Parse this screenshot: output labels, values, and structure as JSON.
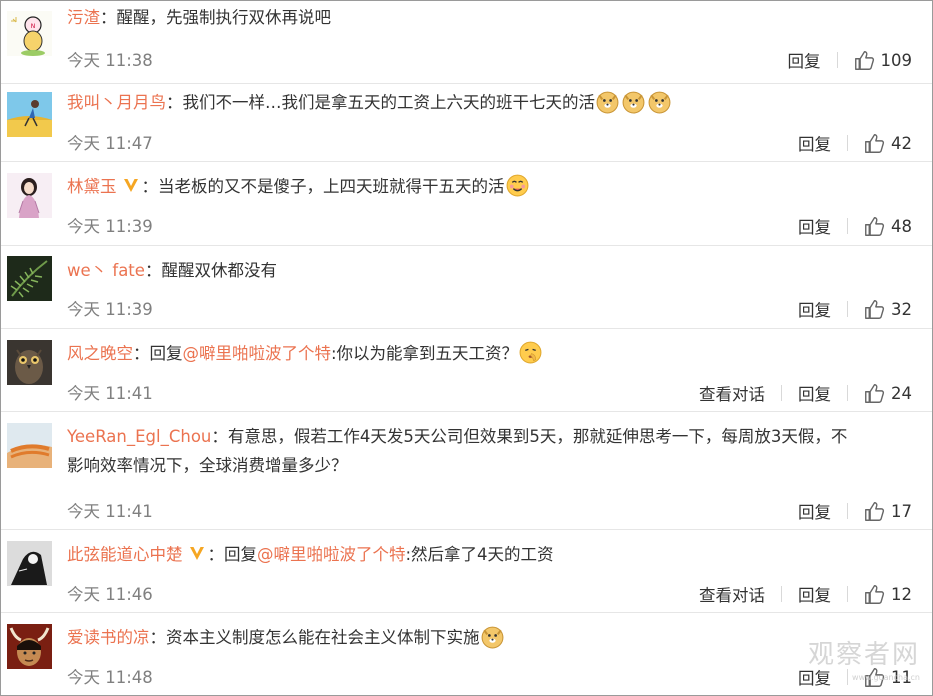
{
  "comments": [
    {
      "user": "污渣",
      "verified": false,
      "reply_prefix": "",
      "mention": "",
      "after_mention": "",
      "text": "：醒醒，先强制执行双休再说吧",
      "text2": "",
      "emojis": 0,
      "time": "今天 11:38",
      "view_conversation": "",
      "reply": "回复",
      "likes": "109"
    },
    {
      "user": "我叫丶月月鸟",
      "verified": false,
      "reply_prefix": "",
      "mention": "",
      "after_mention": "",
      "text": "：我们不一样…我们是拿五天的工资上六天的班干七天的活",
      "text2": "",
      "emojis": 3,
      "time": "今天 11:47",
      "view_conversation": "",
      "reply": "回复",
      "likes": "42"
    },
    {
      "user": "林黛玉",
      "verified": true,
      "reply_prefix": "",
      "mention": "",
      "after_mention": "",
      "text": "：当老板的又不是傻子，上四天班就得干五天的活",
      "text2": "",
      "emojis": 1,
      "time": "今天 11:39",
      "view_conversation": "",
      "reply": "回复",
      "likes": "48"
    },
    {
      "user": "we丶 fate",
      "verified": false,
      "reply_prefix": "",
      "mention": "",
      "after_mention": "",
      "text": "：醒醒双休都没有",
      "text2": "",
      "emojis": 0,
      "time": "今天 11:39",
      "view_conversation": "",
      "reply": "回复",
      "likes": "32"
    },
    {
      "user": "风之晚空",
      "verified": false,
      "reply_prefix": "：回复",
      "mention": "@噼里啪啦波了个特",
      "after_mention": ":你以为能拿到五天工资？",
      "text": "",
      "text2": "",
      "emojis": 1,
      "time": "今天 11:41",
      "view_conversation": "查看对话",
      "reply": "回复",
      "likes": "24"
    },
    {
      "user": "YeeRan_Egl_Chou",
      "verified": false,
      "reply_prefix": "",
      "mention": "",
      "after_mention": "",
      "text": "：有意思，假若工作4天发5天公司但效果到5天，那就延伸思考一下，每周放3天假，不",
      "text2": "影响效率情况下，全球消费增量多少？",
      "emojis": 0,
      "time": "今天 11:41",
      "view_conversation": "",
      "reply": "回复",
      "likes": "17"
    },
    {
      "user": "此弦能道心中楚",
      "verified": true,
      "reply_prefix": "：回复",
      "mention": "@噼里啪啦波了个特",
      "after_mention": ":然后拿了4天的工资",
      "text": "",
      "text2": "",
      "emojis": 0,
      "time": "今天 11:46",
      "view_conversation": "查看对话",
      "reply": "回复",
      "likes": "12"
    },
    {
      "user": "爱读书的凉",
      "verified": false,
      "reply_prefix": "",
      "mention": "",
      "after_mention": "",
      "text": "：资本主义制度怎么能在社会主义体制下实施",
      "text2": "",
      "emojis": 1,
      "time": "今天 11:48",
      "view_conversation": "",
      "reply": "回复",
      "likes": "11"
    }
  ],
  "watermark": {
    "main": "观察者网",
    "sub": "www.guancha.cn"
  },
  "colors": {
    "username": "#eb7350",
    "text": "#333333",
    "time": "#808080",
    "divider": "#e6e6e6"
  }
}
